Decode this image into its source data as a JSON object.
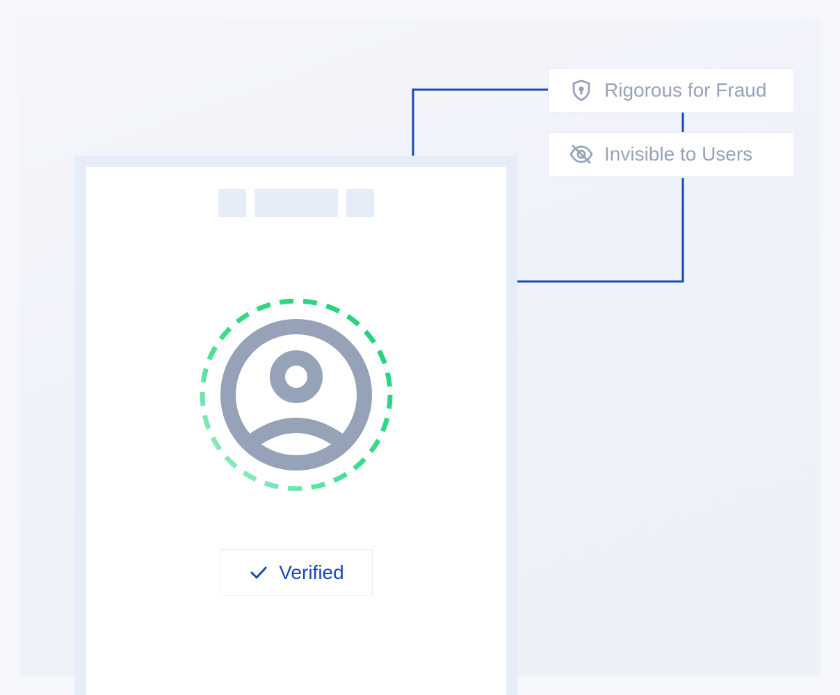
{
  "features": [
    {
      "label": "Rigorous for Fraud",
      "icon": "shield-lock-icon"
    },
    {
      "label": "Invisible to Users",
      "icon": "eye-off-icon"
    }
  ],
  "status": {
    "label": "Verified",
    "icon": "check-icon"
  },
  "avatar": {
    "icon": "user-circle-icon"
  },
  "colors": {
    "connector": "#1747b9",
    "icon_gray": "#95a2b8",
    "ring_green": "#22d17a",
    "frame": "#e6edf9"
  }
}
